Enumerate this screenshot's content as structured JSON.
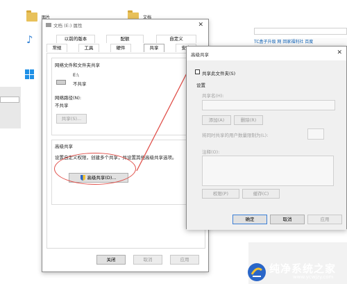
{
  "explorer": {
    "folders": [
      "图片",
      "文档"
    ]
  },
  "browser": {
    "toolbar_text": "TC盒子升级 网 回家福利社 百度",
    "bottom_text": "□"
  },
  "properties": {
    "title": "文档 (E:) 属性",
    "tabs_row1": [
      "以前的版本",
      "配额",
      "自定义"
    ],
    "tabs_row2": [
      "常规",
      "工具",
      "硬件",
      "共享",
      "安全"
    ],
    "net_group_title": "网络文件和文件夹共享",
    "drive_name": "E:\\",
    "drive_status": "不共享",
    "net_path_label": "网络路径(N):",
    "net_path_value": "不共享",
    "share_button": "共享(S)...",
    "adv_group_title": "高级共享",
    "adv_desc": "设置自定义权限，创建多个共享，并设置其他高级共享选项。",
    "adv_button": "高级共享(D)...",
    "buttons": {
      "close": "关闭",
      "cancel": "取消",
      "apply": "应用"
    }
  },
  "advanced": {
    "title": "高级共享",
    "share_checkbox": "共享此文件夹(S)",
    "settings_label": "设置",
    "share_name_label": "共享名(H):",
    "add_button": "添加(A)",
    "remove_button": "删除(R)",
    "limit_label": "将同时共享的用户数量限制为(L):",
    "comment_label": "注释(O):",
    "permissions_button": "权限(P)",
    "cache_button": "缓存(C)",
    "ok_button": "确定",
    "cancel_button": "取消",
    "apply_button": "应用"
  },
  "watermark": {
    "title": "纯净系统之家",
    "url": "www.ycwjzy.com"
  },
  "colors": {
    "annotation_red": "#e0504a",
    "brand_blue": "#2a66c8"
  }
}
